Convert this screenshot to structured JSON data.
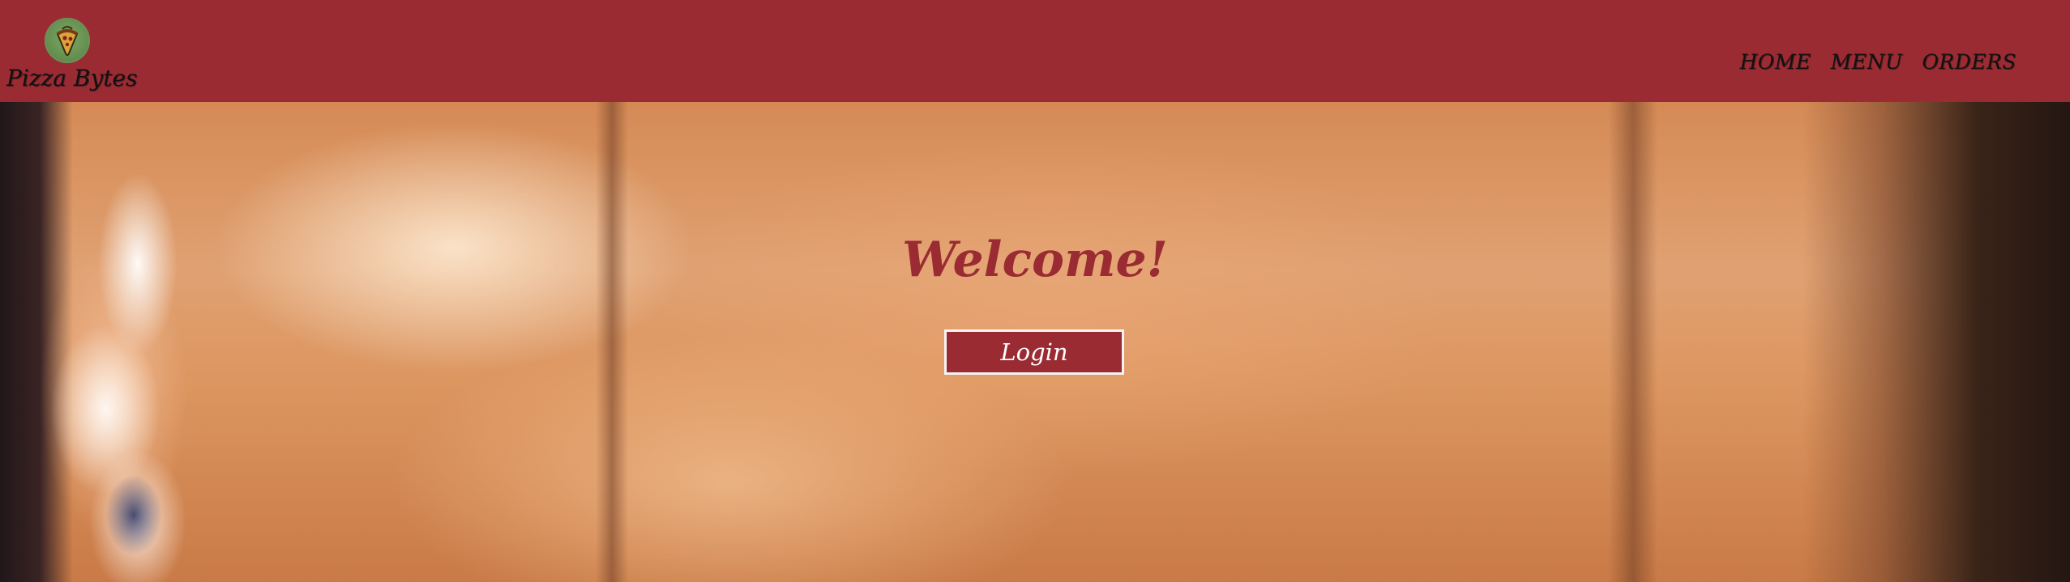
{
  "brand": {
    "name": "Pizza Bytes",
    "logo_icon": "pizza-slice-icon"
  },
  "nav": {
    "items": [
      {
        "label": "HOME"
      },
      {
        "label": "MENU"
      },
      {
        "label": "ORDERS"
      }
    ]
  },
  "hero": {
    "welcome": "Welcome!",
    "login_label": "Login",
    "background": "pizza-oven-fire-image"
  },
  "colors": {
    "brand": "#9a2b33",
    "button_border": "#f4f4f4",
    "nav_text": "#111111"
  }
}
